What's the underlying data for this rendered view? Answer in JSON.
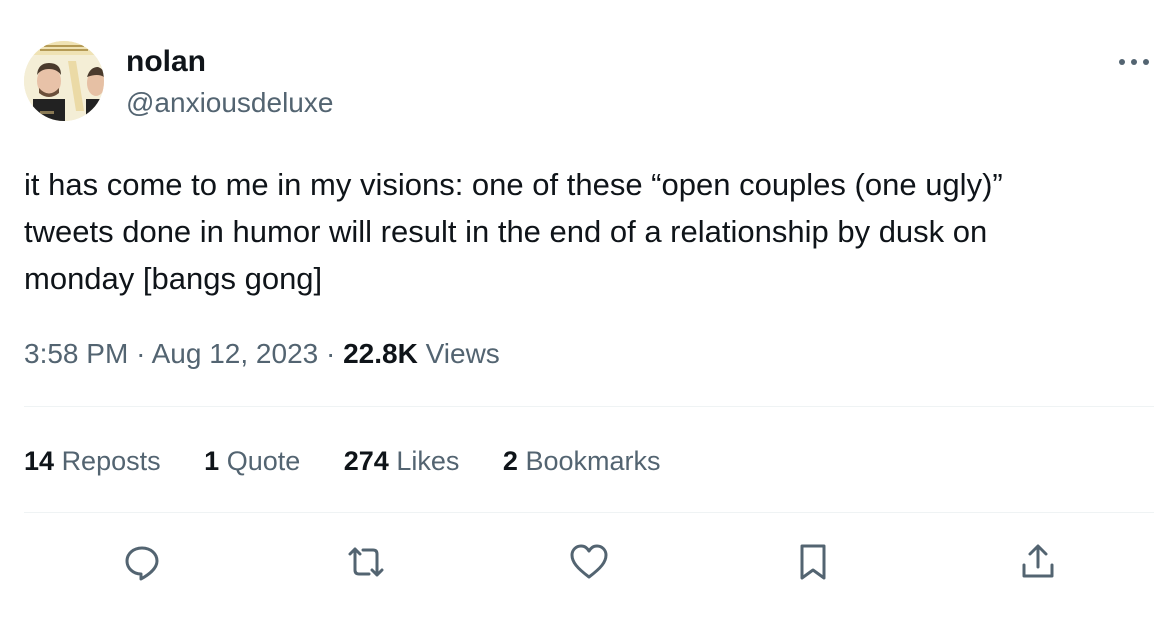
{
  "author": {
    "display_name": "nolan",
    "handle": "@anxiousdeluxe",
    "avatar_icon": "avatar-photo"
  },
  "tweet": {
    "text": "it has come to me in my visions: one of these “open couples (one ugly)”\ntweets done in humor will result in the end of a relationship by dusk on\nmonday [bangs gong]",
    "time": "3:58 PM",
    "separator": "·",
    "date": "Aug 12, 2023",
    "views_count": "22.8K",
    "views_label": "Views"
  },
  "stats": {
    "reposts": {
      "count": "14",
      "label": "Reposts"
    },
    "quotes": {
      "count": "1",
      "label": "Quote"
    },
    "likes": {
      "count": "274",
      "label": "Likes"
    },
    "bookmarks": {
      "count": "2",
      "label": "Bookmarks"
    }
  },
  "actions": [
    "reply-icon",
    "repost-icon",
    "like-icon",
    "bookmark-icon",
    "share-icon"
  ],
  "colors": {
    "text_primary": "#0f1419",
    "text_secondary": "#536471",
    "divider": "#eff3f4"
  }
}
